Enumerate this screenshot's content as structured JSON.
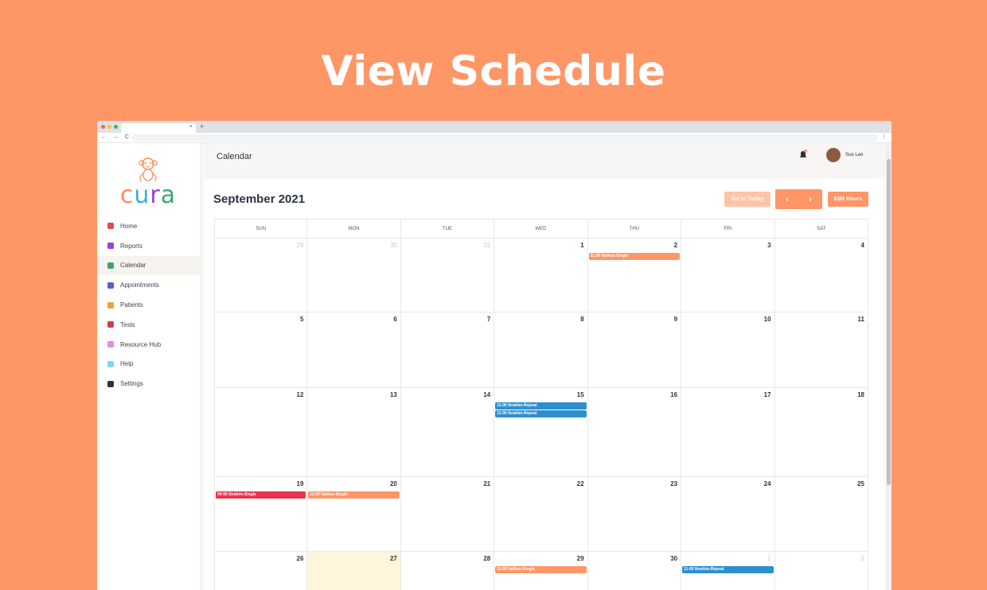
{
  "hero": {
    "title": "View Schedule"
  },
  "browser": {
    "tab_close": "×",
    "new_tab": "+",
    "nav_buttons": "← → C",
    "menu": "⋮"
  },
  "brand": {
    "name": "cura"
  },
  "sidebar": {
    "items": [
      {
        "label": "Home",
        "icon": "home-icon",
        "color": "#e5484d"
      },
      {
        "label": "Reports",
        "icon": "reports-icon",
        "color": "#9b3fd6"
      },
      {
        "label": "Calendar",
        "icon": "calendar-icon",
        "color": "#3aa76d",
        "active": true
      },
      {
        "label": "Appointments",
        "icon": "appointments-icon",
        "color": "#5b5bd6"
      },
      {
        "label": "Patients",
        "icon": "patients-icon",
        "color": "#f0a030"
      },
      {
        "label": "Tests",
        "icon": "tests-icon",
        "color": "#d63a4a"
      },
      {
        "label": "Resource Hub",
        "icon": "resource-hub-icon",
        "color": "#e58be0"
      },
      {
        "label": "Help",
        "icon": "help-icon",
        "color": "#7fd8f0"
      },
      {
        "label": "Settings",
        "icon": "gear-icon",
        "color": "#2a3344"
      }
    ]
  },
  "header": {
    "title": "Calendar",
    "user": "Sue Lee"
  },
  "calendar": {
    "month": "September 2021",
    "today_button": "Go to Today",
    "prev": "‹",
    "next": "›",
    "edit_hours": "Edit Hours",
    "weekdays": [
      "SUN",
      "MON",
      "TUE",
      "WED",
      "THU",
      "FRI",
      "SAT"
    ],
    "weeks": [
      [
        {
          "d": "29",
          "dim": true
        },
        {
          "d": "30",
          "dim": true
        },
        {
          "d": "31",
          "dim": true
        },
        {
          "d": "1"
        },
        {
          "d": "2"
        },
        {
          "d": "3"
        },
        {
          "d": "4"
        }
      ],
      [
        {
          "d": "5"
        },
        {
          "d": "6"
        },
        {
          "d": "7"
        },
        {
          "d": "8"
        },
        {
          "d": "9"
        },
        {
          "d": "10"
        },
        {
          "d": "11"
        }
      ],
      [
        {
          "d": "12"
        },
        {
          "d": "13"
        },
        {
          "d": "14"
        },
        {
          "d": "15"
        },
        {
          "d": "16"
        },
        {
          "d": "17"
        },
        {
          "d": "18"
        }
      ],
      [
        {
          "d": "19"
        },
        {
          "d": "20"
        },
        {
          "d": "21"
        },
        {
          "d": "22"
        },
        {
          "d": "23"
        },
        {
          "d": "24"
        },
        {
          "d": "25"
        }
      ],
      [
        {
          "d": "26"
        },
        {
          "d": "27",
          "today": true
        },
        {
          "d": "28"
        },
        {
          "d": "29"
        },
        {
          "d": "30"
        },
        {
          "d": "1",
          "dim": true
        },
        {
          "d": "2",
          "dim": true
        }
      ]
    ],
    "events": [
      {
        "week": 0,
        "day": 4,
        "slot": 0,
        "label": "11:00 Nathan-Single",
        "color": "#ff9666"
      },
      {
        "week": 2,
        "day": 3,
        "slot": 0,
        "label": "11:00 Ibrahim-Repeat",
        "color": "#2d8fd0"
      },
      {
        "week": 2,
        "day": 3,
        "slot": 1,
        "label": "11:00 Ibrahim-Repeat",
        "color": "#2d8fd0"
      },
      {
        "week": 3,
        "day": 0,
        "slot": 0,
        "label": "09:00 Ibrahim-Single",
        "color": "#e8334f"
      },
      {
        "week": 3,
        "day": 1,
        "slot": 0,
        "label": "11:00 Nathan-Single",
        "color": "#ff9666"
      },
      {
        "week": 4,
        "day": 3,
        "slot": 0,
        "label": "11:00 Nathan-Single",
        "color": "#ff9666"
      },
      {
        "week": 4,
        "day": 5,
        "slot": 0,
        "label": "11:00 Ibrahim-Repeat",
        "color": "#2d8fd0"
      }
    ]
  }
}
